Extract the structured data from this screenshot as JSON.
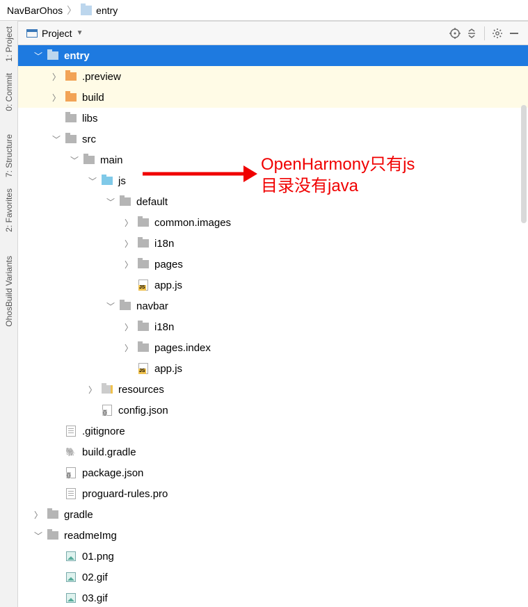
{
  "breadcrumb": {
    "root": "NavBarOhos",
    "module": "entry"
  },
  "panelHeader": {
    "viewSelectorLabel": "Project"
  },
  "sideTabs": [
    {
      "label": "1: Project"
    },
    {
      "label": "0: Commit"
    },
    {
      "label": "7: Structure"
    },
    {
      "label": "2: Favorites"
    },
    {
      "label": "OhosBuild Variants"
    }
  ],
  "annotation": {
    "line1": "OpenHarmony只有js",
    "line2": "目录没有java"
  },
  "tree": [
    {
      "depth": 0,
      "arrow": "down",
      "iconType": "folder",
      "iconColor": "blue",
      "name": "entry",
      "cls": "selected"
    },
    {
      "depth": 1,
      "arrow": "right",
      "iconType": "folder",
      "iconColor": "orange",
      "name": ".preview",
      "cls": "warm"
    },
    {
      "depth": 1,
      "arrow": "right",
      "iconType": "folder",
      "iconColor": "orange",
      "name": "build",
      "cls": "warm"
    },
    {
      "depth": 1,
      "arrow": "none",
      "iconType": "folder",
      "iconColor": "grey",
      "name": "libs"
    },
    {
      "depth": 1,
      "arrow": "down",
      "iconType": "folder",
      "iconColor": "grey",
      "name": "src"
    },
    {
      "depth": 2,
      "arrow": "down",
      "iconType": "folder",
      "iconColor": "grey",
      "name": "main"
    },
    {
      "depth": 3,
      "arrow": "down",
      "iconType": "folder",
      "iconColor": "lightblue",
      "name": "js"
    },
    {
      "depth": 4,
      "arrow": "down",
      "iconType": "folder",
      "iconColor": "grey",
      "name": "default"
    },
    {
      "depth": 5,
      "arrow": "right",
      "iconType": "folder",
      "iconColor": "grey",
      "name": "common.images"
    },
    {
      "depth": 5,
      "arrow": "right",
      "iconType": "folder",
      "iconColor": "grey",
      "name": "i18n"
    },
    {
      "depth": 5,
      "arrow": "right",
      "iconType": "folder",
      "iconColor": "grey",
      "name": "pages"
    },
    {
      "depth": 5,
      "arrow": "none",
      "iconType": "file",
      "fileKind": "js",
      "name": "app.js"
    },
    {
      "depth": 4,
      "arrow": "down",
      "iconType": "folder",
      "iconColor": "grey",
      "name": "navbar"
    },
    {
      "depth": 5,
      "arrow": "right",
      "iconType": "folder",
      "iconColor": "grey",
      "name": "i18n"
    },
    {
      "depth": 5,
      "arrow": "right",
      "iconType": "folder",
      "iconColor": "grey",
      "name": "pages.index"
    },
    {
      "depth": 5,
      "arrow": "none",
      "iconType": "file",
      "fileKind": "js",
      "name": "app.js"
    },
    {
      "depth": 3,
      "arrow": "right",
      "iconType": "folder",
      "iconColor": "yellowlines",
      "name": "resources"
    },
    {
      "depth": 3,
      "arrow": "none",
      "iconType": "file",
      "fileKind": "json",
      "name": "config.json"
    },
    {
      "depth": 1,
      "arrow": "none",
      "iconType": "file",
      "fileKind": "txt",
      "name": ".gitignore"
    },
    {
      "depth": 1,
      "arrow": "none",
      "iconType": "file",
      "fileKind": "gradle",
      "name": "build.gradle"
    },
    {
      "depth": 1,
      "arrow": "none",
      "iconType": "file",
      "fileKind": "json",
      "name": "package.json"
    },
    {
      "depth": 1,
      "arrow": "none",
      "iconType": "file",
      "fileKind": "txt",
      "name": "proguard-rules.pro"
    },
    {
      "depth": 0,
      "arrow": "right",
      "iconType": "folder",
      "iconColor": "grey",
      "name": "gradle"
    },
    {
      "depth": 0,
      "arrow": "down",
      "iconType": "folder",
      "iconColor": "grey",
      "name": "readmeImg"
    },
    {
      "depth": 1,
      "arrow": "none",
      "iconType": "file",
      "fileKind": "img",
      "name": "01.png"
    },
    {
      "depth": 1,
      "arrow": "none",
      "iconType": "file",
      "fileKind": "img",
      "name": "02.gif"
    },
    {
      "depth": 1,
      "arrow": "none",
      "iconType": "file",
      "fileKind": "img",
      "name": "03.gif"
    }
  ]
}
